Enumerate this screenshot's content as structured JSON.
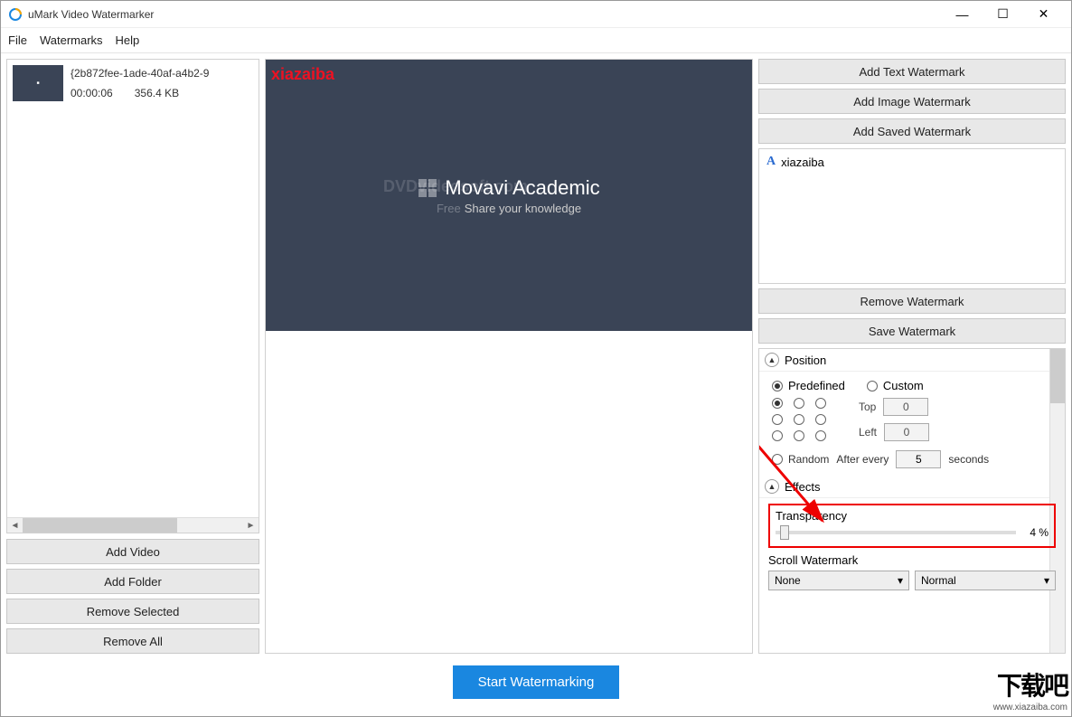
{
  "title": "uMark Video Watermarker",
  "menu": {
    "file": "File",
    "watermarks": "Watermarks",
    "help": "Help"
  },
  "video_list": [
    {
      "name": "{2b872fee-1ade-40af-a4b2-9",
      "duration": "00:00:06",
      "size": "356.4 KB"
    }
  ],
  "left_buttons": {
    "add_video": "Add Video",
    "add_folder": "Add Folder",
    "remove_selected": "Remove Selected",
    "remove_all": "Remove All"
  },
  "preview": {
    "watermark_text": "xiazaiba",
    "center_title": "Movavi Academic",
    "center_subtitle": "Share your knowledge",
    "ghost_text": "DVDvideosoft.com",
    "ghost_prefix": "Free"
  },
  "right_buttons": {
    "add_text": "Add Text Watermark",
    "add_image": "Add Image Watermark",
    "add_saved": "Add Saved Watermark",
    "remove": "Remove Watermark",
    "save": "Save Watermark"
  },
  "watermark_list": [
    {
      "icon": "A",
      "name": "xiazaiba"
    }
  ],
  "position": {
    "header": "Position",
    "predefined_label": "Predefined",
    "custom_label": "Custom",
    "mode": "predefined",
    "grid_selected": 0,
    "top_label": "Top",
    "left_label": "Left",
    "top_value": "0",
    "left_value": "0",
    "random_label": "Random",
    "after_every_label": "After every",
    "after_every_value": "5",
    "seconds_label": "seconds"
  },
  "effects": {
    "header": "Effects",
    "transparency_label": "Transparency",
    "transparency_value": "4 %",
    "scroll_label": "Scroll Watermark",
    "scroll_mode": "None",
    "scroll_speed": "Normal"
  },
  "start_button": "Start Watermarking",
  "corner": {
    "big": "下载吧",
    "small": "www.xiazaiba.com"
  }
}
